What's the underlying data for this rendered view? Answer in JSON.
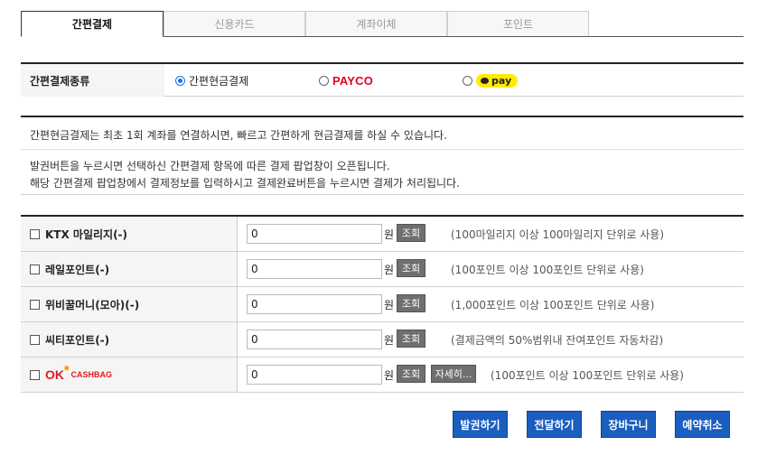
{
  "tabs": [
    {
      "label": "간편결제",
      "active": true
    },
    {
      "label": "신용카드",
      "active": false
    },
    {
      "label": "계좌이체",
      "active": false
    },
    {
      "label": "포인트",
      "active": false
    }
  ],
  "pay_type": {
    "label": "간편결제종류",
    "options": [
      {
        "label": "간편현금결제",
        "checked": true
      },
      {
        "label": "PAYCO",
        "checked": false,
        "icon": "payco-logo"
      },
      {
        "label": "pay",
        "checked": false,
        "icon": "kakaopay-logo"
      }
    ]
  },
  "info": {
    "line1": "간편현금결제는 최초 1회 계좌를 연결하시면, 빠르고 간편하게 현금결제를 하실 수 있습니다.",
    "line2": "발권버튼을 누르시면 선택하신 간편결제 항목에 따른 결제 팝업창이 오픈됩니다.",
    "line3": "해당 간편결제 팝업창에서 결제정보를 입력하시고 결제완료버튼을 누르시면 결제가 처리됩니다."
  },
  "points": [
    {
      "label": "KTX 마일리지(-)",
      "value": "0",
      "unit": "원",
      "lookup": "조회",
      "note": "(100마일리지 이상 100마일리지 단위로 사용)"
    },
    {
      "label": "레일포인트(-)",
      "value": "0",
      "unit": "원",
      "lookup": "조회",
      "note": "(100포인트 이상 100포인트 단위로 사용)"
    },
    {
      "label": "위비꿀머니(모아)(-)",
      "value": "0",
      "unit": "원",
      "lookup": "조회",
      "note": "(1,000포인트 이상 100포인트 단위로 사용)"
    },
    {
      "label": "씨티포인트(-)",
      "value": "0",
      "unit": "원",
      "lookup": "조회",
      "note": "(결제금액의 50%범위내 잔여포인트 자동차감)"
    },
    {
      "label": "OK CASHBAG",
      "logo_ok": "OK",
      "logo_cash": "CASHBAG",
      "value": "0",
      "unit": "원",
      "lookup": "조회",
      "detail": "자세히...",
      "note": "(100포인트 이상 100포인트 단위로 사용)"
    }
  ],
  "actions": {
    "issue": "발권하기",
    "transfer": "전달하기",
    "cart": "장바구니",
    "cancel_reservation": "예약취소"
  },
  "colors": {
    "primary_button": "#1a5ec0",
    "payco": "#e6001f",
    "kakao": "#ffeb00",
    "okcashbag": "#e11b22"
  }
}
